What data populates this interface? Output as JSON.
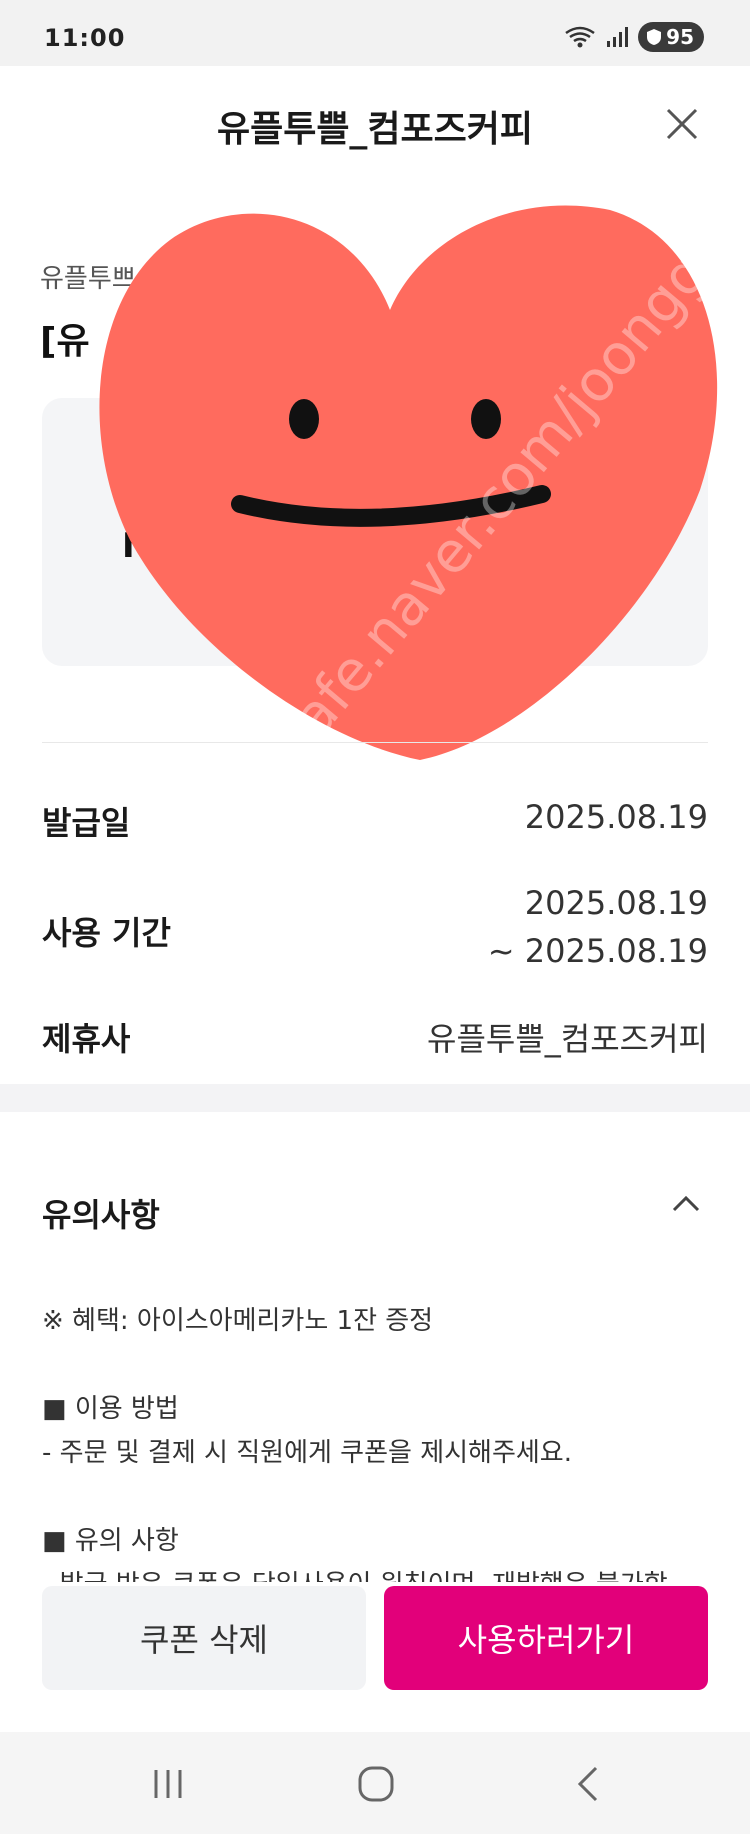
{
  "status_bar": {
    "time": "11:00",
    "battery": "95",
    "icons": [
      "wifi-icon",
      "signal-icon",
      "shield-icon"
    ]
  },
  "header": {
    "title": "유플투쁠_컴포즈커피",
    "close_icon": "close-icon"
  },
  "coupon": {
    "issuer_partial": "유플투쁘",
    "title_partial": "[유",
    "card_text_partial": "I"
  },
  "details": {
    "issue_date_label": "발급일",
    "issue_date": "2025.08.19",
    "period_label": "사용 기간",
    "period_start": "2025.08.19",
    "period_end": "~ 2025.08.19",
    "partner_label": "제휴사",
    "partner": "유플투쁠_컴포즈커피"
  },
  "notice": {
    "header": "유의사항",
    "toggle_icon": "chevron-up-icon",
    "lines": [
      "※ 혜택: 아이스아메리카노 1잔 증정",
      "■ 이용 방법",
      "- 주문 및 결제 시 직원에게 쿠폰을 제시해주세요.",
      "■ 유의 사항",
      "- 발급 받은 쿠폰은 당일사용이 원칙이며, 재발행은 불가합"
    ]
  },
  "actions": {
    "delete_label": "쿠폰 삭제",
    "use_label": "사용하러가기"
  },
  "watermark": {
    "text": "cafe.naver.com/joonggonara"
  },
  "colors": {
    "accent": "#e2007a",
    "sticker_heart": "#ff6b5e",
    "section_gap": "#f3f3f5"
  },
  "nav": {
    "icons": [
      "recent-apps-icon",
      "home-icon",
      "back-icon"
    ]
  }
}
